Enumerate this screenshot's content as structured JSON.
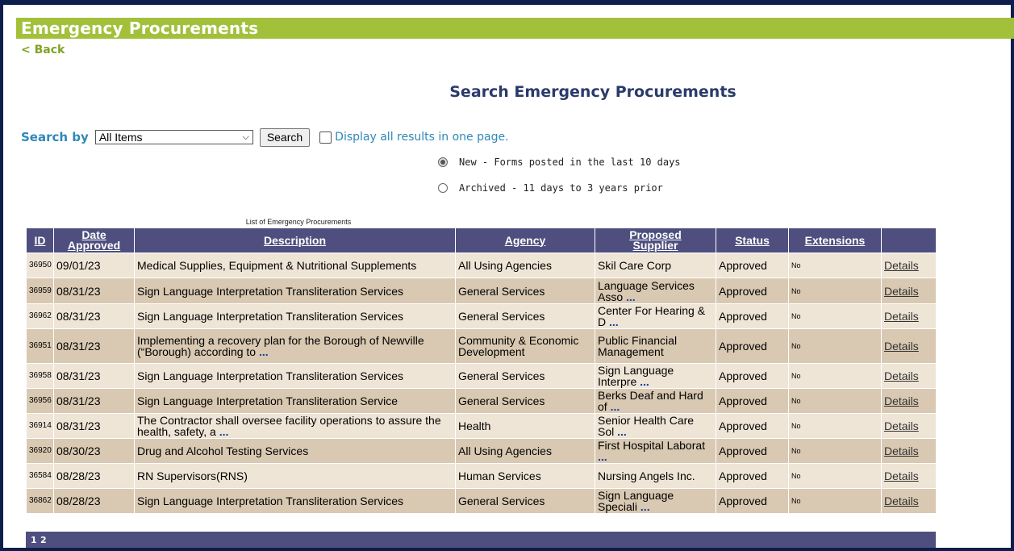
{
  "header": {
    "title": "Emergency Procurements",
    "back_label": "< Back"
  },
  "search": {
    "title": "Search Emergency Procurements",
    "search_by_label": "Search by",
    "select_value": "All Items",
    "button_label": "Search",
    "display_all_label": "Display all results in one page.",
    "radio_new": "New - Forms posted in the last 10 days",
    "radio_archived": "Archived - 11 days to 3 years prior"
  },
  "table": {
    "caption": "List of Emergency Procurements",
    "headers": {
      "id": "ID",
      "date_1": "Date",
      "date_2": "Approved",
      "description": "Description",
      "agency": "Agency",
      "supplier_1": "Proposed",
      "supplier_2": "Supplier",
      "status": "Status",
      "extensions": "Extensions"
    },
    "rows": [
      {
        "id": "36950",
        "date": "09/01/23",
        "desc": "Medical Supplies, Equipment & Nutritional Supplements",
        "desc_more": "",
        "agency": "All Using Agencies",
        "supplier": "Skil Care Corp",
        "supplier_more": "",
        "status": "Approved",
        "ext": "No",
        "details": "Details"
      },
      {
        "id": "36959",
        "date": "08/31/23",
        "desc": "Sign Language Interpretation Transliteration Services",
        "desc_more": "",
        "agency": "General Services",
        "supplier": "Language Services Asso",
        "supplier_more": "...",
        "status": "Approved",
        "ext": "No",
        "details": "Details"
      },
      {
        "id": "36962",
        "date": "08/31/23",
        "desc": "Sign Language Interpretation Transliteration Services",
        "desc_more": "",
        "agency": "General Services",
        "supplier": "Center For Hearing & D",
        "supplier_more": "...",
        "status": "Approved",
        "ext": "No",
        "details": "Details"
      },
      {
        "id": "36951",
        "date": "08/31/23",
        "desc": "Implementing a recovery plan for the Borough of Newville (“Borough) according to",
        "desc_more": "...",
        "agency": "Community & Economic Development",
        "supplier": "Public Financial Management",
        "supplier_more": "",
        "status": "Approved",
        "ext": "No",
        "details": "Details"
      },
      {
        "id": "36958",
        "date": "08/31/23",
        "desc": "Sign Language Interpretation Transliteration Services",
        "desc_more": "",
        "agency": "General Services",
        "supplier": "Sign Language Interpre",
        "supplier_more": "...",
        "status": "Approved",
        "ext": "No",
        "details": "Details"
      },
      {
        "id": "36956",
        "date": "08/31/23",
        "desc": "Sign Language Interpretation Transliteration Service",
        "desc_more": "",
        "agency": "General Services",
        "supplier": "Berks Deaf and Hard of",
        "supplier_more": "...",
        "status": "Approved",
        "ext": "No",
        "details": "Details"
      },
      {
        "id": "36914",
        "date": "08/31/23",
        "desc": "The Contractor shall oversee facility operations to assure the health, safety, a",
        "desc_more": "...",
        "agency": "Health",
        "supplier": "Senior Health Care Sol",
        "supplier_more": "...",
        "status": "Approved",
        "ext": "No",
        "details": "Details"
      },
      {
        "id": "36920",
        "date": "08/30/23",
        "desc": "Drug and Alcohol Testing Services",
        "desc_more": "",
        "agency": "All Using Agencies",
        "supplier": "First Hospital Laborat",
        "supplier_more": "...",
        "status": "Approved",
        "ext": "No",
        "details": "Details"
      },
      {
        "id": "36584",
        "date": "08/28/23",
        "desc": "RN Supervisors(RNS)",
        "desc_more": "",
        "agency": "Human Services",
        "supplier": "Nursing Angels Inc.",
        "supplier_more": "",
        "status": "Approved",
        "ext": "No",
        "details": "Details"
      },
      {
        "id": "36862",
        "date": "08/28/23",
        "desc": "Sign Language Interpretation Transliteration Services",
        "desc_more": "",
        "agency": "General Services",
        "supplier": "Sign Language Speciali",
        "supplier_more": "...",
        "status": "Approved",
        "ext": "No",
        "details": "Details"
      }
    ]
  },
  "pager": {
    "page_1": "1",
    "page_2": "2"
  }
}
